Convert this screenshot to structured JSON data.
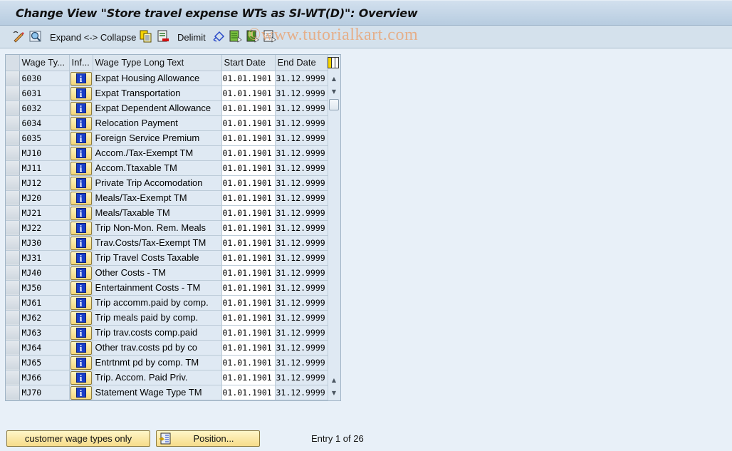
{
  "title": "Change View \"Store travel expense WTs as SI-WT(D)\": Overview",
  "toolbar": {
    "expand_collapse_label": "Expand <-> Collapse",
    "delimit_label": "Delimit",
    "icons": [
      "display-change-icon",
      "find-icon",
      "copy-icon",
      "delete-icon",
      "undo-icon",
      "select-all-icon",
      "select-block-icon",
      "deselect-all-icon"
    ]
  },
  "watermark": "©www.tutorialkart.com",
  "table": {
    "columns": [
      "Wage Ty...",
      "Inf...",
      "Wage Type Long Text",
      "Start Date",
      "End Date"
    ],
    "rows": [
      {
        "code": "6030",
        "text": "Expat Housing Allowance",
        "start": "01.01.1901",
        "end": "31.12.9999"
      },
      {
        "code": "6031",
        "text": "Expat Transportation",
        "start": "01.01.1901",
        "end": "31.12.9999"
      },
      {
        "code": "6032",
        "text": "Expat Dependent Allowance",
        "start": "01.01.1901",
        "end": "31.12.9999"
      },
      {
        "code": "6034",
        "text": "Relocation Payment",
        "start": "01.01.1901",
        "end": "31.12.9999"
      },
      {
        "code": "6035",
        "text": "Foreign Service Premium",
        "start": "01.01.1901",
        "end": "31.12.9999"
      },
      {
        "code": "MJ10",
        "text": "Accom./Tax-Exempt TM",
        "start": "01.01.1901",
        "end": "31.12.9999"
      },
      {
        "code": "MJ11",
        "text": "Accom.Ttaxable TM",
        "start": "01.01.1901",
        "end": "31.12.9999"
      },
      {
        "code": "MJ12",
        "text": "Private Trip Accomodation",
        "start": "01.01.1901",
        "end": "31.12.9999"
      },
      {
        "code": "MJ20",
        "text": "Meals/Tax-Exempt TM",
        "start": "01.01.1901",
        "end": "31.12.9999"
      },
      {
        "code": "MJ21",
        "text": "Meals/Taxable TM",
        "start": "01.01.1901",
        "end": "31.12.9999"
      },
      {
        "code": "MJ22",
        "text": "Trip Non-Mon. Rem. Meals",
        "start": "01.01.1901",
        "end": "31.12.9999"
      },
      {
        "code": "MJ30",
        "text": "Trav.Costs/Tax-Exempt TM",
        "start": "01.01.1901",
        "end": "31.12.9999"
      },
      {
        "code": "MJ31",
        "text": "Trip Travel Costs Taxable",
        "start": "01.01.1901",
        "end": "31.12.9999"
      },
      {
        "code": "MJ40",
        "text": "Other Costs - TM",
        "start": "01.01.1901",
        "end": "31.12.9999"
      },
      {
        "code": "MJ50",
        "text": "Entertainment Costs - TM",
        "start": "01.01.1901",
        "end": "31.12.9999"
      },
      {
        "code": "MJ61",
        "text": "Trip accomm.paid by comp.",
        "start": "01.01.1901",
        "end": "31.12.9999"
      },
      {
        "code": "MJ62",
        "text": "Trip meals paid by comp.",
        "start": "01.01.1901",
        "end": "31.12.9999"
      },
      {
        "code": "MJ63",
        "text": "Trip trav.costs comp.paid",
        "start": "01.01.1901",
        "end": "31.12.9999"
      },
      {
        "code": "MJ64",
        "text": "Other trav.costs pd by co",
        "start": "01.01.1901",
        "end": "31.12.9999"
      },
      {
        "code": "MJ65",
        "text": "Entrtnmt pd by comp. TM",
        "start": "01.01.1901",
        "end": "31.12.9999"
      },
      {
        "code": "MJ66",
        "text": "Trip. Accom. Paid Priv.",
        "start": "01.01.1901",
        "end": "31.12.9999"
      },
      {
        "code": "MJ70",
        "text": "Statement Wage Type  TM",
        "start": "01.01.1901",
        "end": "31.12.9999"
      }
    ],
    "info_glyph": "i"
  },
  "footer": {
    "customer_button_label": "customer wage types only",
    "position_button_label": "Position...",
    "entry_text": "Entry 1 of 26"
  }
}
